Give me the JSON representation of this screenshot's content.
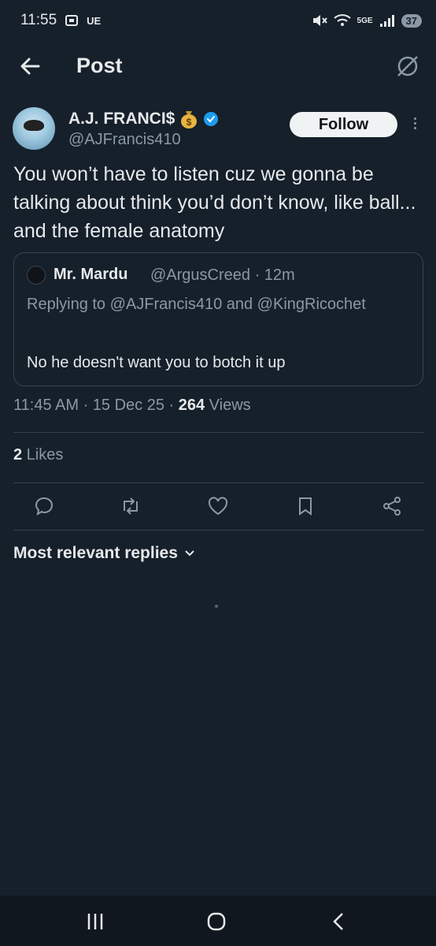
{
  "status_bar": {
    "time": "11:55",
    "carrier_badge": "UE",
    "network": "5GE",
    "battery": "37"
  },
  "header": {
    "title": "Post",
    "back_icon": "arrow-left-icon",
    "grok_icon": "grok-icon"
  },
  "post": {
    "author_name": "A.J. FRANCI$",
    "author_handle": "@AJFrancis410",
    "follow_label": "Follow",
    "text": "You won’t have to listen cuz we gonna be talking about think you’d don’t know, like ball... and the female anatomy",
    "quoted": {
      "name": "Mr. Mardu",
      "meta": "@ArgusCreed · 12m",
      "replying_to": "Replying to @AJFrancis410 and @KingRicochet",
      "text": "No he doesn't want you to botch it up"
    },
    "time_date": "11:45 AM · 15 Dec 25 · ",
    "views_count": "264",
    "views_label": " Views",
    "likes_count": "2",
    "likes_label": " Likes"
  },
  "replies": {
    "sort_label": "Most relevant replies"
  },
  "colors": {
    "background": "#15202b",
    "text": "#e7e9ea",
    "muted": "#8b98a5",
    "verified": "#1d9bf0",
    "border": "#38444d"
  }
}
